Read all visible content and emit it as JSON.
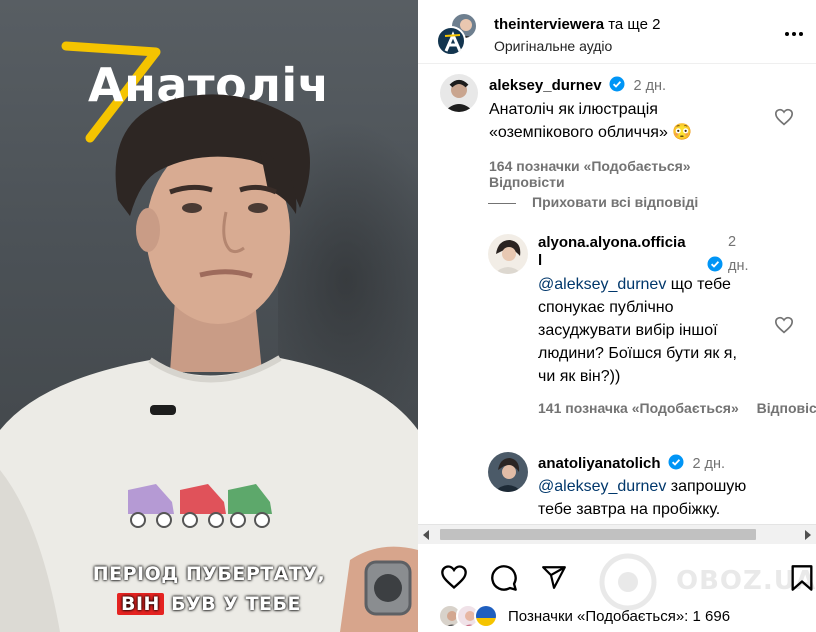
{
  "video": {
    "brand": "Анатоліч",
    "subtitle": {
      "line1": "ПЕРІОД ПУБЕРТАТУ,",
      "line2_highlight": "ВІН",
      "line2_rest": "БУВ У ТЕБЕ"
    },
    "colors": {
      "brand_accent": "#f5c400",
      "subtitle_highlight": "#e52321"
    }
  },
  "post_header": {
    "author": "theinterviewera",
    "and_more": "та ще 2",
    "audio": "Оригінальне аудіо",
    "more_icon": "more-horizontal-icon"
  },
  "comments": [
    {
      "user": "aleksey_durnev",
      "verified": true,
      "time": "2 дн.",
      "text_line1": "Анатоліч як ілюстрація",
      "text_line2": "«оземпікового обличчя» 😳",
      "likes": "164 позначки «Подобається»",
      "reply": "Відповісти"
    }
  ],
  "hide_replies": "Приховати всі відповіді",
  "replies": [
    {
      "user": "alyona.alyona.officia",
      "user_tail": "l",
      "verified": true,
      "time_1": "2",
      "time_2": "дн.",
      "mention": "@aleksey_durnev",
      "text_after_mention": " що тебе",
      "lines": [
        "спонукає публічно",
        "засуджувати вибір іншої",
        "людини? Боїшся бути як я,",
        "чи як він?))"
      ],
      "likes": "141 позначка «Подобається»",
      "reply": "Відповісти"
    },
    {
      "user": "anatoliyanatolich",
      "verified": true,
      "time": "2 дн.",
      "mention": "@aleksey_durnev",
      "text_after_mention": " запрошую",
      "lines": [
        "тебе завтра на пробіжку."
      ]
    }
  ],
  "actions": {
    "like_icon": "heart-icon",
    "comment_icon": "comment-icon",
    "share_icon": "send-icon",
    "save_icon": "bookmark-icon",
    "likes_label": "Позначки «Подобається»:",
    "likes_count": "1 696",
    "watermark": "OBOZ.UA"
  },
  "colors": {
    "verified": "#0095f6",
    "mention": "#00376b",
    "secondary_text": "#737373"
  }
}
